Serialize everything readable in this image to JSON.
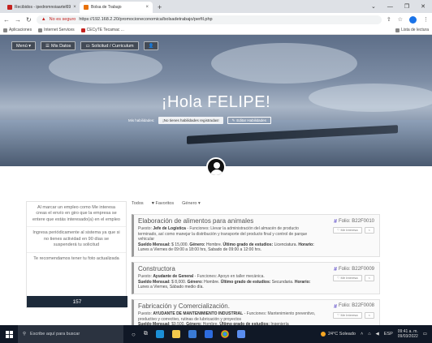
{
  "browser": {
    "tabs": [
      {
        "label": "Recibidos - ipedromnoiaartel69",
        "active": false,
        "color": "#c5221f"
      },
      {
        "label": "Bolsa de Trabajo",
        "active": true,
        "color": "#e8710a"
      }
    ],
    "new_tab": "+",
    "url_warning": "No es seguro",
    "url": "https://192.168.2.20/promocioneconomica/bolsadetrabajo/perfil.php",
    "bookmarks": [
      {
        "label": "Aplicaciones"
      },
      {
        "label": "Internet Services"
      },
      {
        "label": "CECyTE Tecamac ..."
      }
    ],
    "bookmarks_right": "Lista de lectura"
  },
  "app": {
    "nav": [
      {
        "label": "Menú ▾",
        "icon": "menu-icon"
      },
      {
        "label": "Mis Datos",
        "icon": "list-icon"
      },
      {
        "label": "Solicitud / Curriculum",
        "icon": "document-icon"
      },
      {
        "label": "",
        "icon": "user-icon"
      }
    ],
    "greeting": "¡Hola FELIPE!",
    "skills_label": "Mis habilidades:",
    "skills_value": "¡No tienes habilidades registradas!",
    "edit_skills": "Editar Habilidades",
    "sidebar": [
      "Al marcar un empleo como Me interesa creas el envío en giro que la empresa se entere que estás interesado(a) en el empleo",
      "Ingresa periódicamente al sistema ya que si no tienes actividad en 90 días se suspenderá tu solicitud",
      "Te recomendamos tener tu foto actualizada"
    ],
    "sidebar_count": "157",
    "filters": [
      {
        "label": "Todos",
        "icon": ""
      },
      {
        "label": "Favoritos",
        "icon": "heart-icon"
      },
      {
        "label": "Género ▾",
        "icon": ""
      }
    ],
    "jobs": [
      {
        "company": "Elaboración de alimentos para animales",
        "position_label": "Puesto:",
        "position": "Jefe de Logística",
        "description": "- Funciones: Llevar la administración del almacén de producto terminado, así como manejar la distribución y transporte del producto final y control de parque vehicular",
        "salary_label": "Sueldo Mensual:",
        "salary": "$ 15,000.",
        "gender_label": "Género:",
        "gender": "Hombre.",
        "education_label": "Último grado de estudios:",
        "education": "Licenciatura.",
        "schedule_label": "Horario:",
        "schedule": "Lunes a Viernes de 09:00 a 18:00 hrs, Sabado de 09:00 a 12:00 hrs.",
        "folio": "Folio: B22F0010",
        "interest_btn": "Me Interesa",
        "share_btn": "<"
      },
      {
        "company": "Constructora",
        "position_label": "Puesto:",
        "position": "Ayudante de General",
        "description": "- Funciones: Apoyo en taller mecánica.",
        "salary_label": "Sueldo Mensual:",
        "salary": "$ 8,000.",
        "gender_label": "Género:",
        "gender": "Hombre.",
        "education_label": "Último grado de estudios:",
        "education": "Secundaria.",
        "schedule_label": "Horario:",
        "schedule": "Lunes a Viernes, Sábado medio día.",
        "folio": "Folio: B22F0009",
        "interest_btn": "Me Interesa",
        "share_btn": "<"
      },
      {
        "company": "Fabricación y Comercialización.",
        "position_label": "Puesto:",
        "position": "AYUDANTE DE MANTENIMIENTO INDUSTRIAL",
        "description": "- Funciones: Mantenimiento preventivo, productivo y correctivo, rutinas de lubricación y proyectos",
        "salary_label": "Sueldo Mensual:",
        "salary": "$9,500.",
        "gender_label": "Género:",
        "gender": "Hombre.",
        "education_label": "Último grado de estudios:",
        "education": "Ingeniería",
        "schedule_label": "",
        "schedule": "",
        "folio": "Folio: B22F0008",
        "interest_btn": "Me Interesa",
        "share_btn": "<"
      }
    ]
  },
  "taskbar": {
    "search_placeholder": "Escribe aquí para buscar",
    "weather": "24°C Soleado",
    "lang": "ESP",
    "time": "09:41 a. m.",
    "date": "09/03/2022"
  }
}
